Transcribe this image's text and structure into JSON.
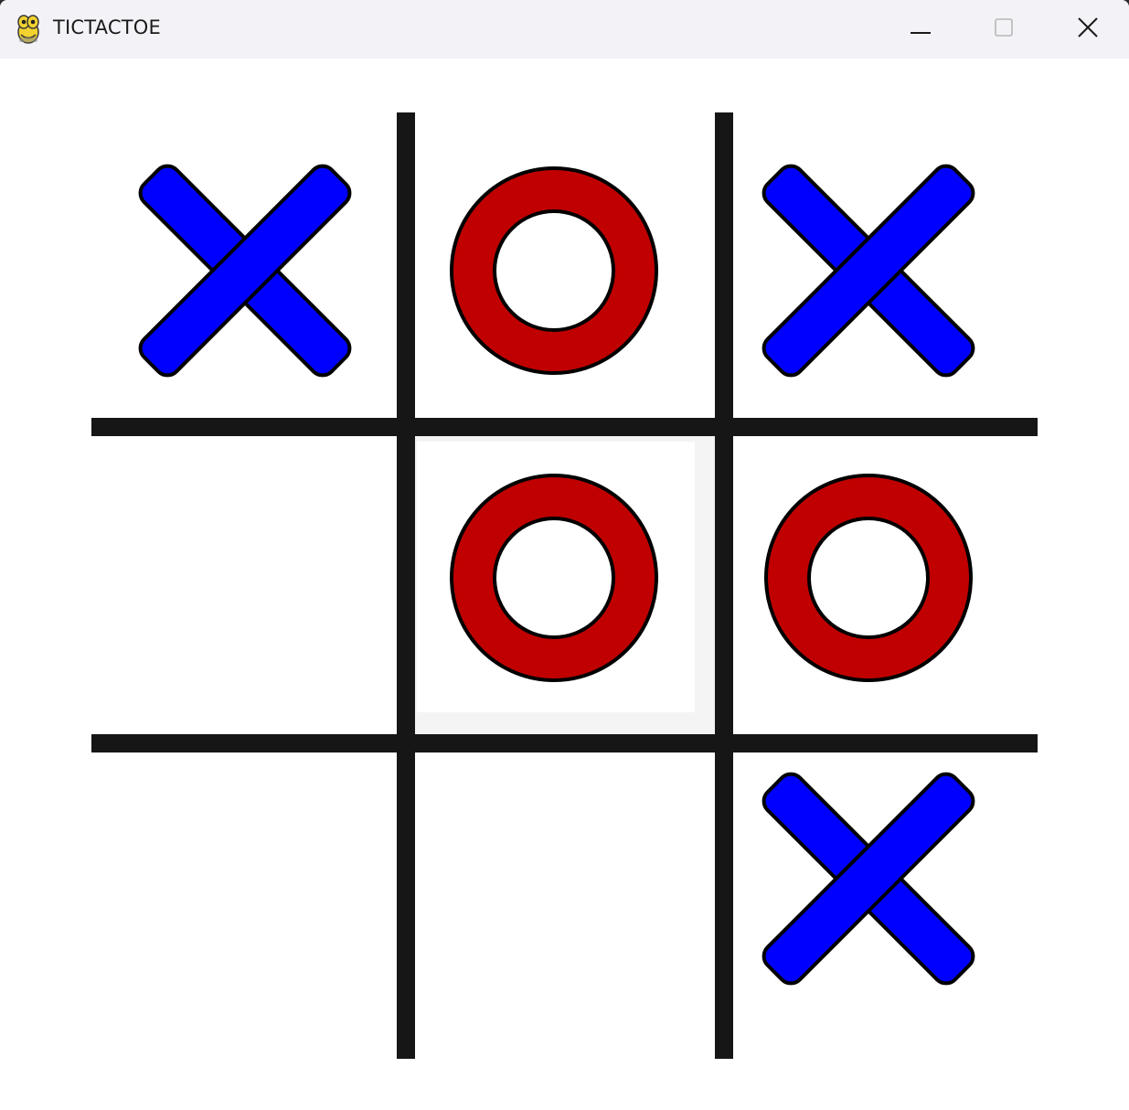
{
  "window": {
    "title": "TICTACTOE",
    "app_icon": "pygame-snake-icon",
    "controls": {
      "minimize_icon": "minimize-icon",
      "maximize_icon": "maximize-icon",
      "close_icon": "close-icon"
    }
  },
  "colors": {
    "titlebar_bg": "#f3f2f7",
    "grid_line": "#161616",
    "x_fill": "#0000ff",
    "o_fill": "#c00000",
    "outline": "#000000",
    "highlight_cell": "#f4f4f4"
  },
  "board": {
    "rows": 3,
    "cols": 3,
    "highlighted_cell": [
      1,
      1
    ],
    "cells": [
      [
        "X",
        "O",
        "X"
      ],
      [
        "",
        "O",
        "O"
      ],
      [
        "",
        "",
        "X"
      ]
    ]
  }
}
